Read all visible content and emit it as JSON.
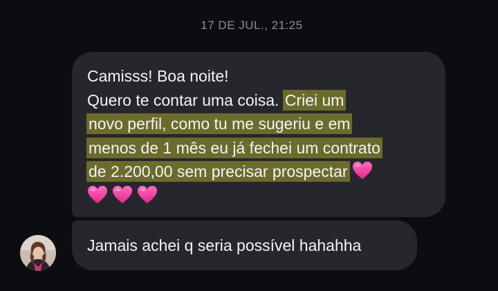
{
  "conversation": {
    "timestamp": "17 DE JUL., 21:25",
    "message_1": {
      "line_1": "Camisss! Boa noite!",
      "line_2_plain": "Quero te contar uma coisa. ",
      "line_2_highlight": "Criei um",
      "line_3": "novo perfil, como tu me sugeriu e em",
      "line_4": "menos de 1 mês eu já fechei um contrato",
      "line_5": "de 2.200,00 sem precisar prospectar",
      "emoji": "pink-heart-icon"
    },
    "message_2": {
      "text": "Jamais achei q seria possível hahahha"
    },
    "colors": {
      "background": "#0c0d11",
      "bubble": "#26272d",
      "highlight": "#6b6b2c",
      "heart": "#f03c9e",
      "timestamp": "#8e8f96"
    }
  }
}
